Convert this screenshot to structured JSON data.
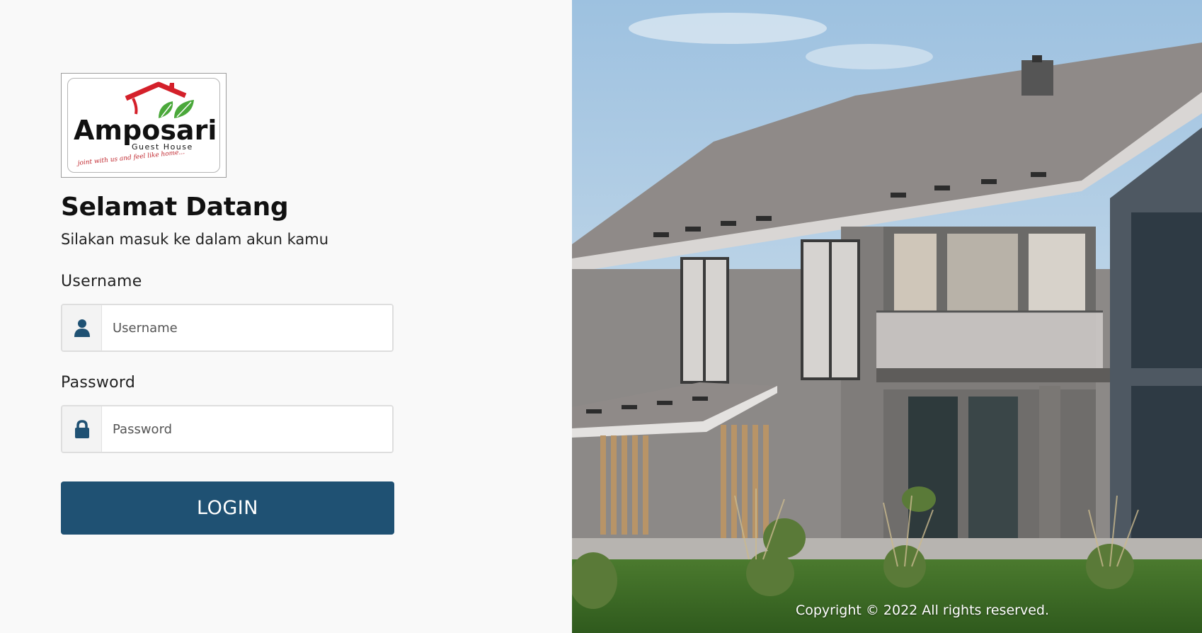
{
  "brand": {
    "logo_name": "Amposari",
    "logo_subtitle": "Guest House",
    "logo_tagline": "joint with us and feel like home..."
  },
  "welcome": {
    "title": "Selamat Datang",
    "subtitle": "Silakan masuk ke dalam akun kamu"
  },
  "form": {
    "username_label": "Username",
    "username_placeholder": "Username",
    "password_label": "Password",
    "password_placeholder": "Password",
    "login_label": "LOGIN"
  },
  "footer": {
    "copyright": "Copyright © 2022 All rights reserved."
  },
  "colors": {
    "primary": "#1f5173",
    "background": "#f9f9f9",
    "logo_red": "#d4202a",
    "logo_green": "#4aa83a"
  }
}
